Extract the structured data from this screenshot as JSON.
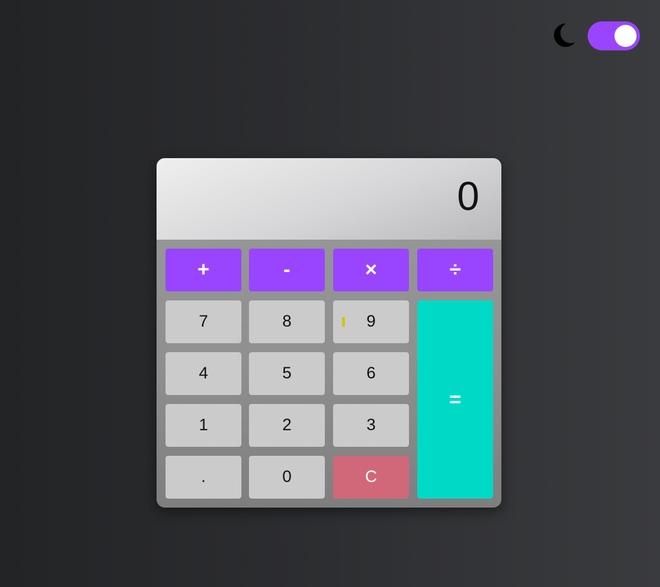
{
  "theme": {
    "moon_icon": "moon-icon",
    "toggle_on": true,
    "toggle_color": "#9945ff"
  },
  "calculator": {
    "display": "0",
    "operators": [
      "+",
      "-",
      "×",
      "÷"
    ],
    "digits": {
      "seven": "7",
      "eight": "8",
      "nine": "9",
      "four": "4",
      "five": "5",
      "six": "6",
      "one": "1",
      "two": "2",
      "three": "3",
      "decimal": ".",
      "zero": "0"
    },
    "clear": "C",
    "equals": "=",
    "colors": {
      "operator": "#9945ff",
      "equals": "#00d9c6",
      "clear": "#d0687a",
      "digit": "#cbcbcb"
    }
  }
}
